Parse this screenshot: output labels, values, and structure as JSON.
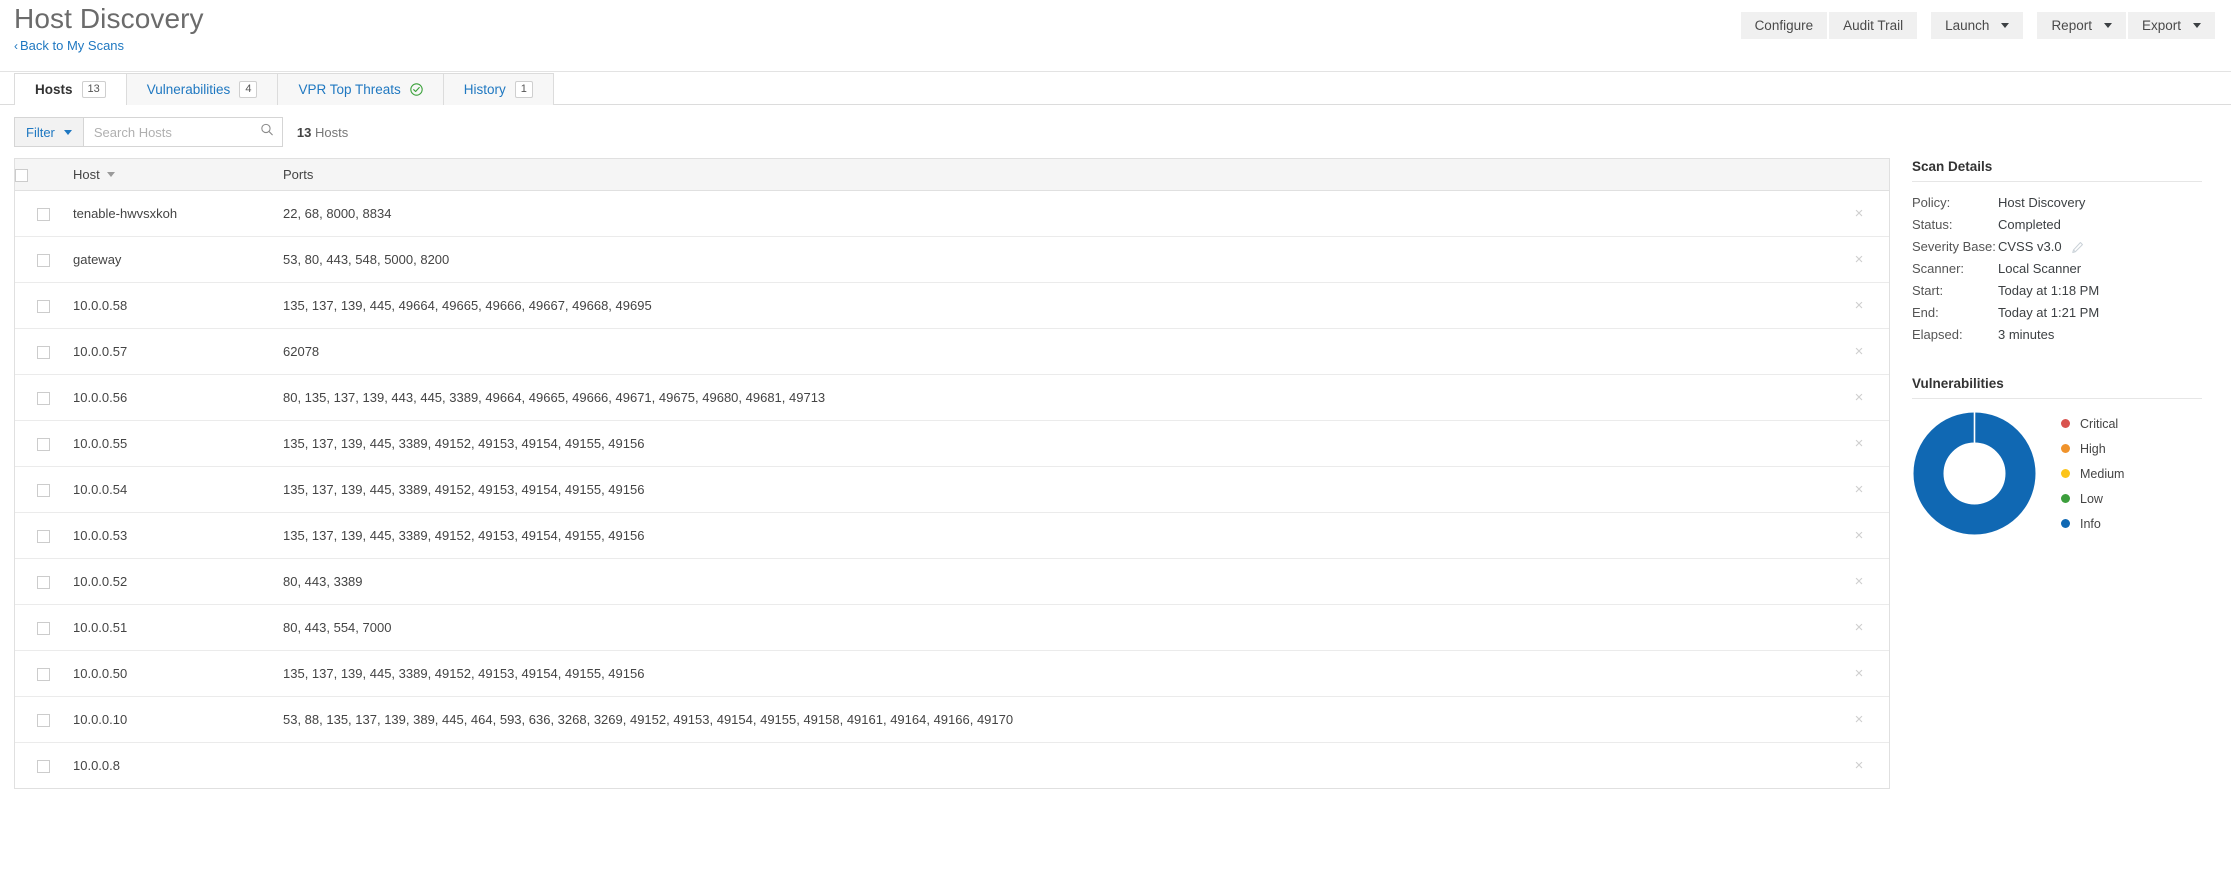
{
  "header": {
    "title": "Host Discovery",
    "back_link": "Back to My Scans",
    "back_chevron": "‹",
    "actions": [
      {
        "label": "Configure",
        "caret": false
      },
      {
        "label": "Audit Trail",
        "caret": false
      },
      {
        "label": "Launch",
        "caret": true
      },
      {
        "label": "Report",
        "caret": true
      },
      {
        "label": "Export",
        "caret": true
      }
    ]
  },
  "tabs": [
    {
      "label": "Hosts",
      "badge": "13",
      "active": true,
      "icon": null
    },
    {
      "label": "Vulnerabilities",
      "badge": "4",
      "active": false,
      "icon": null
    },
    {
      "label": "VPR Top Threats",
      "badge": null,
      "active": false,
      "icon": "check-circle-icon"
    },
    {
      "label": "History",
      "badge": "1",
      "active": false,
      "icon": null
    }
  ],
  "filter_bar": {
    "filter_label": "Filter",
    "search_placeholder": "Search Hosts",
    "search_value": "",
    "count_number": "13",
    "count_label": "Hosts"
  },
  "table": {
    "columns": [
      "",
      "Host",
      "Ports",
      ""
    ],
    "sort_column": "Host",
    "sort_direction": "desc",
    "rows": [
      {
        "host": "tenable-hwvsxkoh",
        "ports": "22, 68, 8000, 8834"
      },
      {
        "host": "gateway",
        "ports": "53, 80, 443, 548, 5000, 8200"
      },
      {
        "host": "10.0.0.58",
        "ports": "135, 137, 139, 445, 49664, 49665, 49666, 49667, 49668, 49695"
      },
      {
        "host": "10.0.0.57",
        "ports": "62078"
      },
      {
        "host": "10.0.0.56",
        "ports": "80, 135, 137, 139, 443, 445, 3389, 49664, 49665, 49666, 49671, 49675, 49680, 49681, 49713"
      },
      {
        "host": "10.0.0.55",
        "ports": "135, 137, 139, 445, 3389, 49152, 49153, 49154, 49155, 49156"
      },
      {
        "host": "10.0.0.54",
        "ports": "135, 137, 139, 445, 3389, 49152, 49153, 49154, 49155, 49156"
      },
      {
        "host": "10.0.0.53",
        "ports": "135, 137, 139, 445, 3389, 49152, 49153, 49154, 49155, 49156"
      },
      {
        "host": "10.0.0.52",
        "ports": "80, 443, 3389"
      },
      {
        "host": "10.0.0.51",
        "ports": "80, 443, 554, 7000"
      },
      {
        "host": "10.0.0.50",
        "ports": "135, 137, 139, 445, 3389, 49152, 49153, 49154, 49155, 49156"
      },
      {
        "host": "10.0.0.10",
        "ports": "53, 88, 135, 137, 139, 389, 445, 464, 593, 636, 3268, 3269, 49152, 49153, 49154, 49155, 49158, 49161, 49164, 49166, 49170"
      },
      {
        "host": "10.0.0.8",
        "ports": ""
      }
    ],
    "delete_glyph": "×"
  },
  "scan_details": {
    "title": "Scan Details",
    "rows": [
      {
        "label": "Policy:",
        "value": "Host Discovery",
        "edit": false
      },
      {
        "label": "Status:",
        "value": "Completed",
        "edit": false
      },
      {
        "label": "Severity Base:",
        "value": "CVSS v3.0",
        "edit": true
      },
      {
        "label": "Scanner:",
        "value": "Local Scanner",
        "edit": false
      },
      {
        "label": "Start:",
        "value": "Today at 1:18 PM",
        "edit": false
      },
      {
        "label": "End:",
        "value": "Today at 1:21 PM",
        "edit": false
      },
      {
        "label": "Elapsed:",
        "value": "3 minutes",
        "edit": false
      }
    ]
  },
  "vulnerabilities": {
    "title": "Vulnerabilities"
  },
  "chart_data": {
    "type": "pie",
    "title": "Vulnerabilities",
    "legend_position": "right",
    "donut": true,
    "categories": [
      "Critical",
      "High",
      "Medium",
      "Low",
      "Info"
    ],
    "values": [
      0,
      0,
      0,
      0,
      100
    ],
    "colors": [
      "#d9534f",
      "#f0932b",
      "#fcc419",
      "#3c9e3c",
      "#1068b3"
    ],
    "labels_shown": false
  },
  "colors": {
    "link": "#1f78c1",
    "info_blue": "#1068b3",
    "critical": "#d9534f",
    "high": "#f0932b",
    "medium": "#fcc419",
    "low": "#3c9e3c",
    "check_green": "#3aa13a"
  }
}
